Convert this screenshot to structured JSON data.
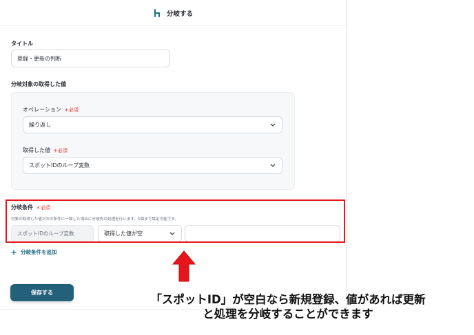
{
  "header": {
    "title": "分岐する",
    "icon": "branch-icon"
  },
  "title_field": {
    "label": "タイトル",
    "value": "登録・更新の判断"
  },
  "section_label": "分岐対象の取得した値",
  "operation": {
    "label": "オペレーション",
    "required": "＊必須",
    "value": "繰り返し"
  },
  "acquired_value": {
    "label": "取得した値",
    "required": "＊必須",
    "value": "スポットIDのループ変数"
  },
  "condition": {
    "label": "分岐条件",
    "required": "＊必須",
    "description": "対象の取得した値が次の条件に一致した場合に分岐先の処理を行います。5個まで設定可能です。",
    "field_value": "スポットIDのループ変数",
    "operator": "取得した値が空",
    "compare_value": ""
  },
  "add_condition": "分岐条件を追加",
  "save_button": "保存する",
  "annotation": {
    "line1": "「スポットID」が空白なら新規登録、値があれば更新",
    "line2": "と処理を分岐することができます",
    "arrow_color": "#e5161b"
  },
  "colors": {
    "accent": "#23617a",
    "highlight": "#e5161b",
    "required": "#e0342f"
  }
}
